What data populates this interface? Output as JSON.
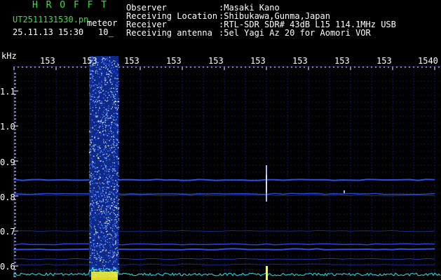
{
  "header": {
    "app_title": "H R O F F T",
    "filename": "UT2511131530.pn",
    "mode": "meteor",
    "date_time": "25.11.13 15:30",
    "interval": "10_",
    "info": [
      {
        "label": "Observer",
        "value": ":Masaki Kano"
      },
      {
        "label": "Receiving Location",
        "value": ":Shibukawa,Gunma,Japan"
      },
      {
        "label": "Receiver",
        "value": ":RTL-SDR SDR# 43dB L15 114.1MHz USB"
      },
      {
        "label": "Receiving antenna",
        "value": ":5el Yagi Az 20 for Aomori VOR"
      }
    ]
  },
  "time_axis": {
    "ticks": [
      "153",
      "153",
      "153",
      "153",
      "153",
      "153",
      "153",
      "153",
      "153",
      "1540"
    ]
  },
  "freq_axis": {
    "unit": "kHz",
    "ticks": [
      "1.1",
      "1.0",
      "0.9",
      "0.8",
      "0.7",
      "0.6"
    ]
  },
  "colors": {
    "background": "#000000",
    "grid": "#25257a",
    "signal": "#2f57ff",
    "burst": "#6a9cff",
    "level": "#28e6f0",
    "event": "#ffff30",
    "labels": "#ffffff",
    "title": "#33e633"
  }
}
